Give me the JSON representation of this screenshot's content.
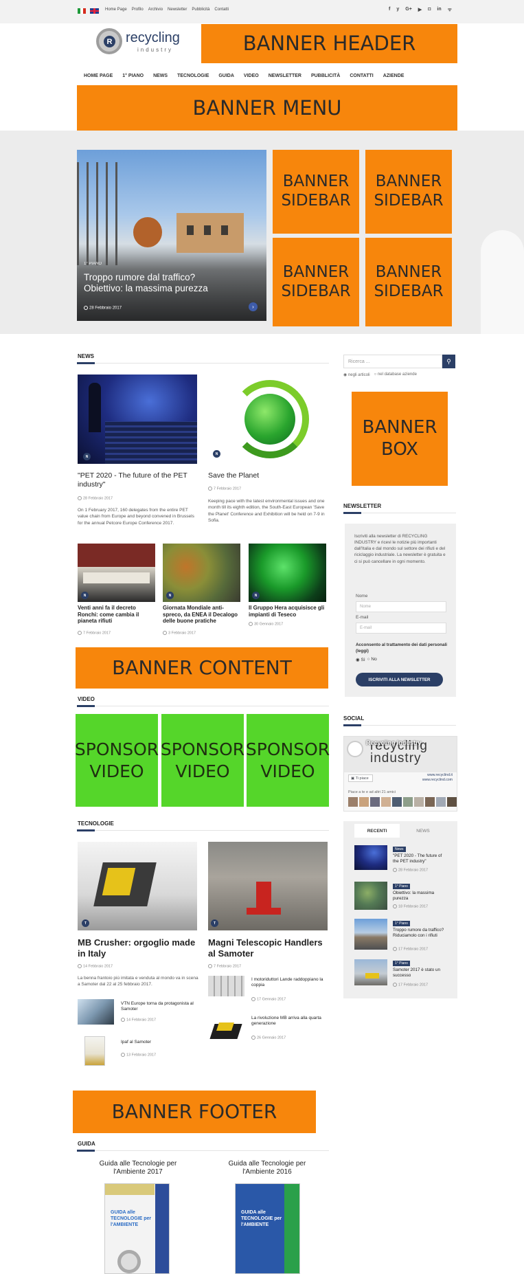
{
  "topbar": {
    "links": [
      "Home Page",
      "Profilo",
      "Archivio",
      "Newsletter",
      "Pubblicità",
      "Contatti"
    ],
    "social_icons": [
      "f",
      "y",
      "G+",
      "in-youtube",
      "cam",
      "in",
      "rss"
    ]
  },
  "logo": {
    "text": "recycling",
    "sub": "industry",
    "letter": "R"
  },
  "banners": {
    "header": "BANNER HEADER",
    "menu": "BANNER MENU",
    "sidebar": "BANNER SIDEBAR",
    "box": "BANNER BOX",
    "content": "BANNER CONTENT",
    "footer": "BANNER FOOTER",
    "sponsor": "SPONSOR VIDEO"
  },
  "menu": [
    "HOME PAGE",
    "1° PIANO",
    "NEWS",
    "TECNOLOGIE",
    "GUIDA",
    "VIDEO",
    "NEWSLETTER",
    "PUBBLICITÀ",
    "CONTATTI",
    "AZIENDE"
  ],
  "hero": {
    "category": "1° PIANO",
    "title": "Troppo rumore dal traffico? Obiettivo: la massima purezza",
    "date": "28 Febbraio 2017"
  },
  "news": {
    "title": "NEWS",
    "featured": [
      {
        "badge": "N",
        "title": "\"PET 2020 - The future of the PET industry\"",
        "date": "28 Febbraio 2017",
        "text": "On 1 February 2017, 160 delegates from the entire PET value chain from Europe and beyond convened in Brussels for the annual Petcore Europe Conference 2017."
      },
      {
        "badge": "N",
        "title": "Save the Planet",
        "date": "7 Febbraio 2017",
        "text": "Keeping pace with the latest environmental issues and one month till its eighth edition, the South-East European 'Save the Planet' Conference and Exhibition will be held on 7-9 in Sofia."
      }
    ],
    "small": [
      {
        "badge": "N",
        "title": "Venti anni fa il decreto Ronchi: come cambia il pianeta rifiuti",
        "date": "7 Febbraio 2017"
      },
      {
        "badge": "N",
        "title": "Giornata Mondiale anti-spreco, da ENEA il Decalogo delle buone pratiche",
        "date": "3 Febbraio 2017"
      },
      {
        "badge": "N",
        "title": "Il Gruppo Hera acquisisce gli impianti di Teseco",
        "date": "30 Gennaio 2017"
      }
    ]
  },
  "video": {
    "title": "VIDEO"
  },
  "tecnologie": {
    "title": "TECNOLOGIE",
    "featured": [
      {
        "badge": "T",
        "title": "MB Crusher: orgoglio made in Italy",
        "date": "14 Febbraio 2017",
        "text": "La benna frantoio più imitata e venduta al mondo va in scena a Samoter dal 22 al 25 febbraio 2017."
      },
      {
        "badge": "T",
        "title": "Magni Telescopic Handlers al Samoter",
        "date": "7 Febbraio 2017"
      }
    ],
    "list_left": [
      {
        "title": "VTN Europe torna da protagonista al Samoter",
        "date": "14 Febbraio 2017"
      },
      {
        "title": "Ipaf al Samoter",
        "date": "13 Febbraio 2017"
      }
    ],
    "list_right": [
      {
        "title": "I motoriduttori Lande raddoppiano la coppia",
        "date": "17 Gennaio 2017"
      },
      {
        "title": "La rivoluzione MB arriva alla quarta generazione",
        "date": "26 Gennaio 2017"
      }
    ]
  },
  "guida": {
    "title": "GUIDA",
    "items": [
      {
        "title": "Guida alle Tecnologie per l'Ambiente 2017",
        "cover_text": "GUIDA alle TECNOLOGIE per l'AMBIENTE"
      },
      {
        "title": "Guida alle Tecnologie per l'Ambiente 2016",
        "cover_text": "GUIDA alle TECNOLOGIE per l'AMBIENTE"
      }
    ]
  },
  "sidebar": {
    "search_placeholder": "Ricerca ...",
    "search_opts": [
      "negli articoli",
      "nel database aziende"
    ],
    "newsletter_title": "NEWSLETTER",
    "newsletter_text": "Iscriviti alla newsletter di RECYCLING INDUSTRY e ricevi le notizie più importanti dall'Italia e dal mondo sul settore dei rifiuti e del riciclaggio industriale. La newsletter è gratuita e ci si può cancellare in ogni momento.",
    "nome_label": "Nome",
    "nome_placeholder": "Nome",
    "email_label": "E-mail",
    "email_placeholder": "E-mail",
    "consent": "Acconsento al trattamento dei dati personali (leggi)",
    "consent_yes": "Sì",
    "consent_no": "No",
    "subscribe": "ISCRIVITI ALLA NEWSLETTER",
    "social_title": "SOCIAL",
    "fb_name": "Recycling Industry",
    "fb_cover": "recycling industry",
    "fb_like": "Ti piace",
    "fb_url1": "www.recyclind.it",
    "fb_url2": "www.recyclind.com",
    "fb_friends": "Piace a te e ad altri 21 amici",
    "tabs": [
      "RECENTI",
      "NEWS"
    ],
    "recent": [
      {
        "tag": "News",
        "title": "\"PET 2020 - The future of the PET industry\"",
        "date": "28 Febbraio 2017"
      },
      {
        "tag": "1° Piano",
        "title": "Obiettivo: la massima purezza",
        "date": "18 Febbraio 2017"
      },
      {
        "tag": "1° Piano",
        "title": "Troppo rumore da traffico? Riduciamolo con i rifiuti",
        "date": "17 Febbraio 2017"
      },
      {
        "tag": "1° Piano",
        "title": "Samoter 2017 è stato un successo",
        "date": "17 Febbraio 2017"
      }
    ]
  },
  "colors": {
    "accent": "#2b3f66",
    "orange": "#f7860c",
    "green": "#55d62a"
  }
}
